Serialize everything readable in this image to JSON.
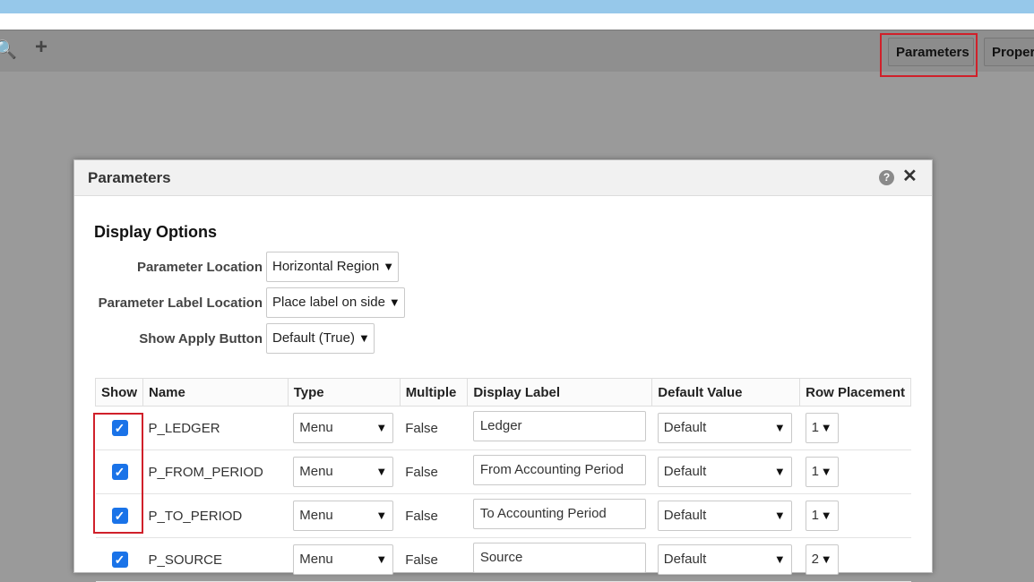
{
  "toolbar": {
    "search_icon": "search-icon",
    "add_icon": "plus-icon",
    "parameters_button": "Parameters",
    "properties_button": "Proper"
  },
  "dialog": {
    "title": "Parameters",
    "help_symbol": "?",
    "close_symbol": "✕",
    "section_title": "Display Options",
    "options": {
      "param_location": {
        "label": "Parameter Location",
        "value": "Horizontal Region"
      },
      "label_location": {
        "label": "Parameter Label Location",
        "value": "Place label on side"
      },
      "apply_button": {
        "label": "Show Apply Button",
        "value": "Default (True)"
      }
    },
    "table": {
      "headers": [
        "Show",
        "Name",
        "Type",
        "Multiple",
        "Display Label",
        "Default Value",
        "Row Placement"
      ],
      "rows": [
        {
          "show": true,
          "name": "P_LEDGER",
          "type": "Menu",
          "multiple": "False",
          "label": "Ledger",
          "default": "Default",
          "row": "1"
        },
        {
          "show": true,
          "name": "P_FROM_PERIOD",
          "type": "Menu",
          "multiple": "False",
          "label": "From Accounting Period",
          "default": "Default",
          "row": "1"
        },
        {
          "show": true,
          "name": "P_TO_PERIOD",
          "type": "Menu",
          "multiple": "False",
          "label": "To Accounting Period",
          "default": "Default",
          "row": "1"
        },
        {
          "show": true,
          "name": "P_SOURCE",
          "type": "Menu",
          "multiple": "False",
          "label": "Source",
          "default": "Default",
          "row": "2"
        }
      ]
    }
  },
  "colors": {
    "highlight": "#d0202a",
    "checkbox": "#1a73e8",
    "top_band": "#96c8ea"
  }
}
